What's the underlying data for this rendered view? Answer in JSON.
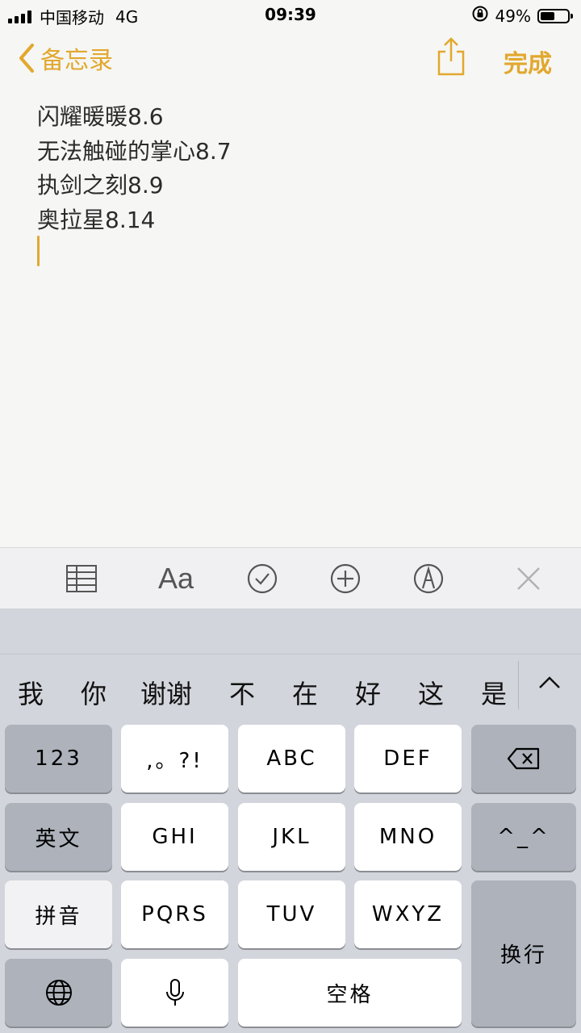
{
  "status_bar": {
    "carrier": "中国移动",
    "network": "4G",
    "time": "09:39",
    "battery": "49%",
    "icons": [
      "signal-icon",
      "orientation-lock-icon",
      "battery-icon"
    ]
  },
  "nav": {
    "back_label": "备忘录",
    "done_label": "完成",
    "icons": [
      "chevron-left-icon",
      "share-icon"
    ]
  },
  "note": {
    "lines": [
      "闪耀暖暖8.6",
      "无法触碰的掌心8.7",
      "执剑之刻8.9",
      "奥拉星8.14"
    ]
  },
  "toolbar": {
    "format_label": "Aa",
    "icons": [
      "table-icon",
      "format-icon",
      "checklist-icon",
      "add-icon",
      "markup-icon",
      "close-icon"
    ]
  },
  "keyboard": {
    "candidates": [
      "我",
      "你",
      "谢谢",
      "不",
      "在",
      "好",
      "这",
      "是"
    ],
    "keys": {
      "num": "123",
      "punct": ",。?!",
      "abc": "ABC",
      "def": "DEF",
      "english": "英文",
      "ghi": "GHI",
      "jkl": "JKL",
      "mno": "MNO",
      "emoji": "^_^",
      "pinyin": "拼音",
      "pqrs": "PQRS",
      "tuv": "TUV",
      "wxyz": "WXYZ",
      "return": "换行",
      "space": "空格"
    },
    "icons": [
      "chevron-up-icon",
      "delete-icon",
      "globe-icon",
      "microphone-icon"
    ]
  },
  "colors": {
    "accent": "#e2a82e",
    "background": "#f6f6f4",
    "keyboard_bg": "#d2d5db",
    "key_white": "#ffffff",
    "key_gray": "#adb2bb"
  }
}
